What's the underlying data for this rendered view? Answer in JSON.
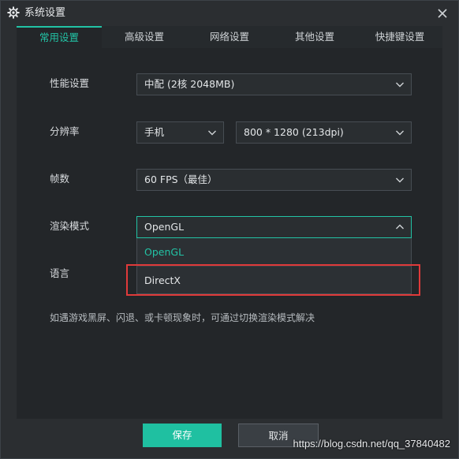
{
  "window": {
    "title": "系统设置"
  },
  "tabs": [
    {
      "label": "常用设置",
      "active": true
    },
    {
      "label": "高级设置",
      "active": false
    },
    {
      "label": "网络设置",
      "active": false
    },
    {
      "label": "其他设置",
      "active": false
    },
    {
      "label": "快捷键设置",
      "active": false
    }
  ],
  "settings": {
    "performance": {
      "label": "性能设置",
      "value": "中配 (2核 2048MB)"
    },
    "resolution": {
      "label": "分辨率",
      "device": "手机",
      "value": "800 * 1280 (213dpi)"
    },
    "fps": {
      "label": "帧数",
      "value": "60 FPS（最佳）"
    },
    "render": {
      "label": "渲染模式",
      "value": "OpenGL",
      "options": [
        "OpenGL",
        "DirectX"
      ]
    },
    "language": {
      "label": "语言"
    }
  },
  "hint": "如遇游戏黑屏、闪退、或卡顿现象时，可通过切换渲染模式解决",
  "buttons": {
    "save": "保存",
    "cancel": "取消"
  },
  "watermark": "https://blog.csdn.net/qq_37840482",
  "colors": {
    "accent": "#22c3a5",
    "highlight": "#e03a3a"
  }
}
